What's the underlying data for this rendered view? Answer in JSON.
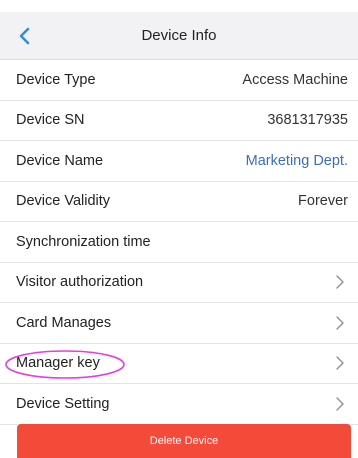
{
  "navbar": {
    "back_icon": "chevron-left-icon",
    "title": "Device Info"
  },
  "rows": [
    {
      "label": "Device Type",
      "value": "Access Machine",
      "kind": "value"
    },
    {
      "label": "Device SN",
      "value": "3681317935",
      "kind": "value"
    },
    {
      "label": "Device Name",
      "value": "Marketing Dept.",
      "kind": "link"
    },
    {
      "label": "Device Validity",
      "value": "Forever",
      "kind": "value"
    },
    {
      "label": "Synchronization time",
      "value": "",
      "kind": "value"
    },
    {
      "label": "Visitor authorization",
      "kind": "nav"
    },
    {
      "label": "Card Manages",
      "kind": "nav"
    },
    {
      "label": "Manager key",
      "kind": "nav",
      "highlighted": true
    },
    {
      "label": "Device Setting",
      "kind": "nav"
    }
  ],
  "delete_button": {
    "label": "Delete Device"
  },
  "colors": {
    "accent": "#2f8fd8",
    "link": "#3b6fb5",
    "danger": "#f44a3a",
    "highlight": "#e040e0",
    "navbar_bg": "#f2f2f4"
  }
}
